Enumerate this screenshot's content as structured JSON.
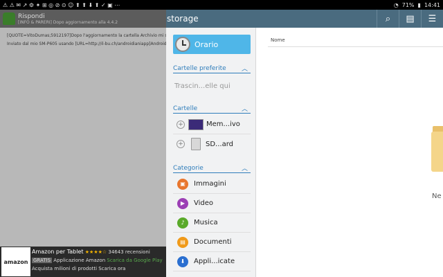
{
  "statusbar": {
    "left_icons": "⚠ ⚠ ✉ ↗ ⚙ ✦ ⊞ ◎ ⊘ ⊙ ☺ ⬆ ⬆ ⬇ ⬆ ✓ ▣ ⋯",
    "battery": "71%",
    "time": "14:41"
  },
  "forum": {
    "title": "Rispondi",
    "subtitle": "[INFO & PARERI] Dopo aggiornamento alla 4.4.2",
    "line1": "[QUOTE=VitoDumas;5912197]Dopo l'aggiornamento la cartella Archivio mi s",
    "line2": "Inviato dal mio SM-P605 usando [URL=http://il-bu.ch/androidianiapp]Android"
  },
  "ad": {
    "logo_text": "amazon",
    "title": "Amazon per Tablet",
    "stars": "★★★★☆",
    "reviews": "34643 recensioni",
    "badge": "GRATIS",
    "category": "Applicazione Amazon",
    "store": "Scarica da Google Play",
    "cta": "Acquista milioni di prodotti Scarica ora"
  },
  "fm": {
    "title": "storage",
    "tools": [
      "search-icon",
      "sd-card-icon",
      "list-icon"
    ],
    "orario": "Orario",
    "sections": {
      "favorites": "Cartelle preferite",
      "folders": "Cartelle",
      "categories": "Categorie"
    },
    "favorites_placeholder": "Trascin...elle qui",
    "folders": [
      "Mem...ivo",
      "SD...ard"
    ],
    "categories": [
      {
        "label": "Immagini",
        "color": "#e8762e"
      },
      {
        "label": "Video",
        "color": "#9c3fb5"
      },
      {
        "label": "Musica",
        "color": "#5aaa2a"
      },
      {
        "label": "Documenti",
        "color": "#f09a1a"
      },
      {
        "label": "Appli...icate",
        "color": "#2a6fd0"
      }
    ],
    "column_name": "Nome",
    "empty_text": "Ne"
  }
}
